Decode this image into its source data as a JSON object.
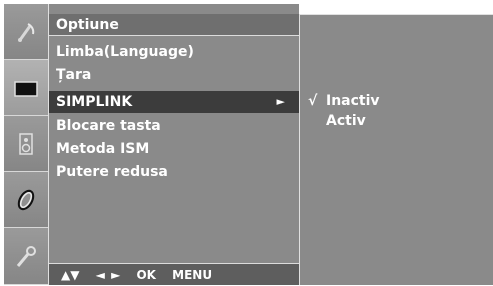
{
  "menu": {
    "title": "Optiune",
    "items": [
      {
        "label": "Limba(Language)"
      },
      {
        "label": "Țara"
      },
      {
        "label": "SIMPLINK",
        "arrow": "►"
      },
      {
        "label": "Blocare tasta"
      },
      {
        "label": "Metoda ISM"
      },
      {
        "label": "Putere redusa"
      }
    ],
    "selected_index": 2,
    "footer": {
      "updown": "▲▼",
      "leftright": "◄ ►",
      "ok": "OK",
      "menu": "MENU"
    }
  },
  "submenu": {
    "items": [
      {
        "check": "√",
        "label": "Inactiv"
      },
      {
        "check": "",
        "label": "Activ"
      }
    ]
  },
  "rail": {
    "icons": [
      "satellite-dish-icon",
      "screen-icon",
      "speaker-icon",
      "clock-icon",
      "option-icon"
    ],
    "active_index": 1
  },
  "colors": {
    "panel": "#8a8a8a",
    "selected": "#3c3c3c",
    "title_bar": "#6f6f6f",
    "text": "#ffffff"
  }
}
